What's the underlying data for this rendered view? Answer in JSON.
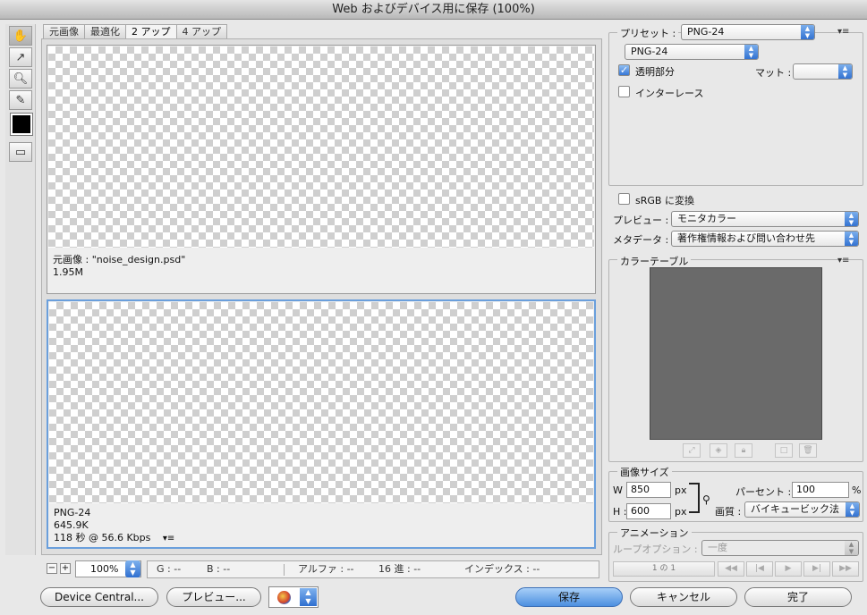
{
  "window": {
    "title": "Web およびデバイス用に保存 (100%)"
  },
  "tools": {
    "items": [
      "hand-tool",
      "slice-select-tool",
      "zoom-tool",
      "eyedropper-tool"
    ],
    "eyedropper_color": "#000000",
    "toggle_slices": "slice-visibility-toggle"
  },
  "tabs": [
    {
      "label": "元画像"
    },
    {
      "label": "最適化"
    },
    {
      "label": "2 アップ"
    },
    {
      "label": "4 アップ"
    }
  ],
  "original_pane": {
    "name": "元画像 : \"noise_design.psd\"",
    "size": "1.95M"
  },
  "optimized_pane": {
    "format": "PNG-24",
    "size": "645.9K",
    "download": "118 秒 @ 56.6 Kbps",
    "menu_glyph": "▾≡"
  },
  "bottom": {
    "zoom_out": "−",
    "zoom_in": "+",
    "zoom": "100%",
    "info": {
      "g": "G : --",
      "b": "B : --",
      "alpha": "アルファ : --",
      "hex": "16 進 : --",
      "index": "インデックス : --"
    }
  },
  "buttons": {
    "device_central": "Device Central...",
    "preview": "プレビュー...",
    "save": "保存",
    "cancel": "キャンセル",
    "done": "完了"
  },
  "settings": {
    "preset_label": "プリセット :",
    "preset_value": "PNG-24",
    "format_value": "PNG-24",
    "transparency_label": "透明部分",
    "transparency_checked": true,
    "matte_label": "マット :",
    "matte_value": "",
    "interlace_label": "インターレース",
    "interlace_checked": false,
    "srgb_label": "sRGB に変換",
    "srgb_checked": false,
    "preview_label": "プレビュー :",
    "preview_value": "モニタカラー",
    "metadata_label": "メタデータ :",
    "metadata_value": "著作権情報および問い合わせ先",
    "menu_glyph": "▾≡"
  },
  "color_table": {
    "title": "カラーテーブル",
    "fill": "#6a6a6a",
    "menu_glyph": "▾≡"
  },
  "image_size": {
    "title": "画像サイズ",
    "w_label": "W :",
    "w_value": "850",
    "h_label": "H :",
    "h_value": "600",
    "unit": "px",
    "percent_label": "パーセント :",
    "percent_value": "100",
    "percent_unit": "%",
    "quality_label": "画質 :",
    "quality_value": "バイキュービック法"
  },
  "animation": {
    "title": "アニメーション",
    "loop_label": "ループオプション :",
    "loop_value": "一度",
    "frame_counter": "1 の 1"
  },
  "colors": {
    "accent": "#3c7fdc",
    "selection_border": "#6a9fdc",
    "panel_bg": "#e8e8e8"
  }
}
